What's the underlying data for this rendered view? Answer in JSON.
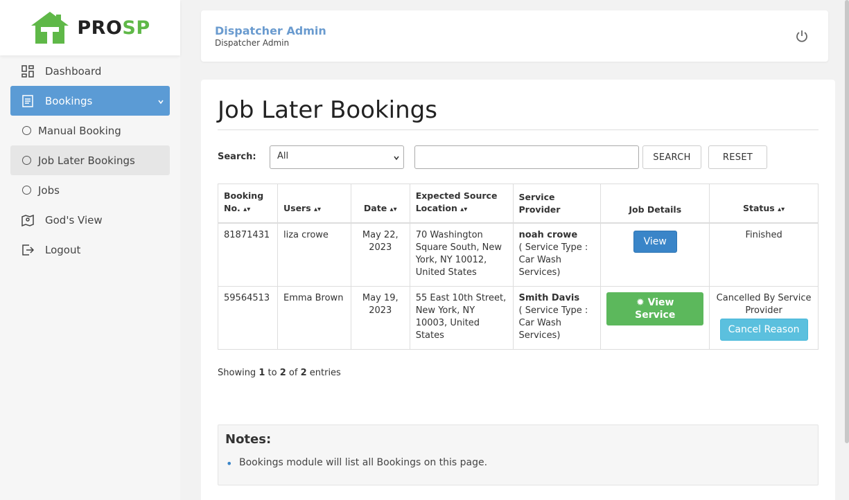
{
  "brand": {
    "logo_part1": "PRO",
    "logo_part2": "SP",
    "green": "#5fb848",
    "accent": "#5b9bd5"
  },
  "sidebar": {
    "items": [
      {
        "label": "Dashboard",
        "icon": "dashboard-icon"
      },
      {
        "label": "Bookings",
        "icon": "list-icon"
      },
      {
        "label": "Manual Booking"
      },
      {
        "label": "Job Later Bookings"
      },
      {
        "label": "Jobs"
      },
      {
        "label": "God's View",
        "icon": "map-pin-icon"
      },
      {
        "label": "Logout",
        "icon": "logout-icon"
      }
    ]
  },
  "header": {
    "title": "Dispatcher Admin",
    "subtitle": "Dispatcher Admin"
  },
  "main": {
    "title": "Job Later Bookings",
    "search_label": "Search:",
    "select_value": "All",
    "search_input_value": "",
    "search_button": "SEARCH",
    "reset_button": "RESET",
    "columns": [
      "Booking No.",
      "Users",
      "Date",
      "Expected Source Location",
      "Service Provider",
      "Job Details",
      "Status"
    ],
    "rows": [
      {
        "booking_no": "81871431",
        "user": "liza crowe",
        "date": "May 22, 2023",
        "location": "70 Washington Square South, New York, NY 10012, United States",
        "provider_name": "noah crowe",
        "provider_type": "( Service Type : Car Wash Services)",
        "job_button": "View",
        "status": "Finished"
      },
      {
        "booking_no": "59564513",
        "user": "Emma Brown",
        "date": "May 19, 2023",
        "location": "55 East 10th Street, New York, NY 10003, United States",
        "provider_name": "Smith Davis",
        "provider_type": "( Service Type : Car Wash Services)",
        "job_button": "View Service",
        "status": "Cancelled By Service Provider",
        "status_button": "Cancel Reason"
      }
    ],
    "showing": {
      "prefix": "Showing",
      "from": "1",
      "to_word": "to",
      "to": "2",
      "of_word": "of",
      "total": "2",
      "suffix": "entries"
    },
    "notes_title": "Notes:",
    "notes": [
      "Bookings module will list all Bookings on this page."
    ]
  }
}
